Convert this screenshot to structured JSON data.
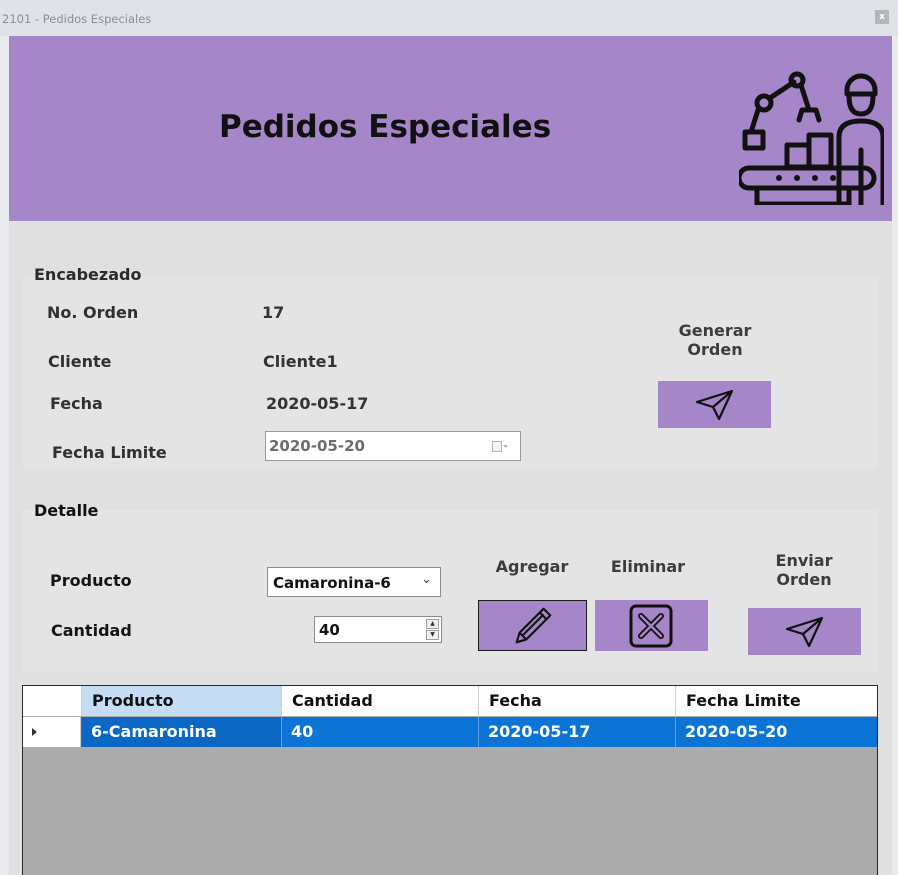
{
  "window": {
    "title": "2101 - Pedidos Especiales",
    "close_glyph": "x"
  },
  "banner": {
    "title": "Pedidos Especiales",
    "icon": "factory-assembly-line-icon",
    "color": "#a586c8"
  },
  "header_group": {
    "title": "Encabezado",
    "orden_label": "No. Orden",
    "orden_value": "17",
    "cliente_label": "Cliente",
    "cliente_value": "Cliente1",
    "fecha_label": "Fecha",
    "fecha_value": "2020-05-17",
    "fecha_limite_label": "Fecha Limite",
    "fecha_limite_value": "2020-05-20",
    "generar_label_line1": "Generar",
    "generar_label_line2": "Orden"
  },
  "detail_group": {
    "title": "Detalle",
    "producto_label": "Producto",
    "producto_value": "Camaronina-6",
    "cantidad_label": "Cantidad",
    "cantidad_value": "40",
    "agregar_label": "Agregar",
    "eliminar_label": "Eliminar",
    "enviar_label_line1": "Enviar",
    "enviar_label_line2": "Orden"
  },
  "grid": {
    "columns": [
      "Producto",
      "Cantidad",
      "Fecha",
      "Fecha Limite"
    ],
    "rows": [
      {
        "producto": "6-Camaronina",
        "cantidad": "40",
        "fecha": "2020-05-17",
        "fecha_limite": "2020-05-20"
      }
    ],
    "selection_color": "#0b74d4"
  }
}
